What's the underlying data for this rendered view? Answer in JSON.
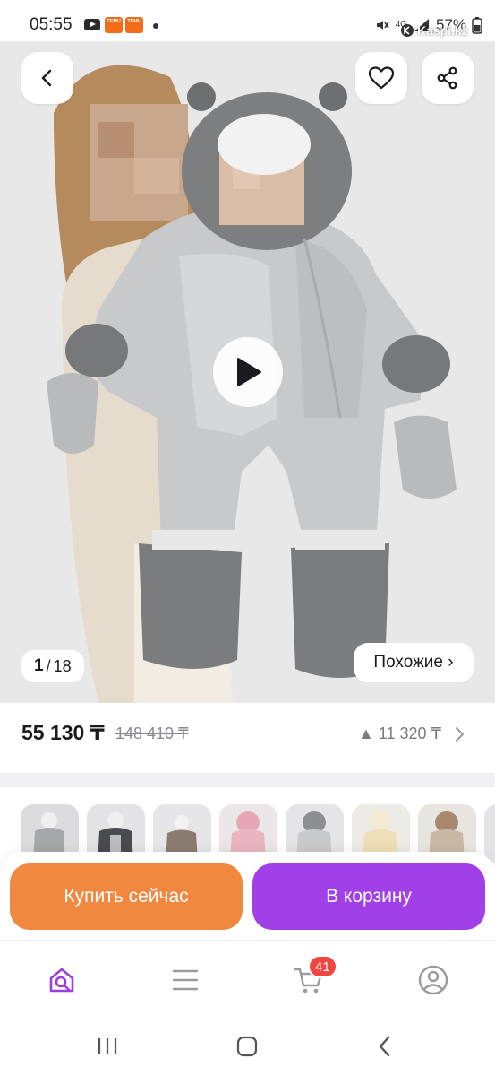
{
  "status_bar": {
    "time": "05:55",
    "battery": "57%",
    "network": "4G",
    "temu_label": "TEMU",
    "temu_label_2": "TEMU"
  },
  "watermark": "Kaspi.kz",
  "gallery": {
    "counter_current": "1",
    "counter_separator": "/",
    "counter_total": "18",
    "similar_label": "Похожие ›",
    "icons": [
      "back-icon",
      "heart-icon",
      "share-icon",
      "play-icon"
    ]
  },
  "price": {
    "current": "55 130 ₸",
    "old": "148 410 ₸",
    "delta": "▲ 11 320 ₸"
  },
  "thumbnails": [
    "photo-1",
    "photo-2",
    "photo-3",
    "photo-4",
    "photo-5",
    "photo-6",
    "photo-7",
    "photo-8"
  ],
  "actions": {
    "buy_now": "Купить сейчас",
    "add_to_cart": "В корзину"
  },
  "bottom_nav": {
    "items": [
      "home-search",
      "menu",
      "cart",
      "profile"
    ],
    "cart_badge": "41"
  },
  "colors": {
    "buy_button": "#f0893f",
    "cart_button": "#a140e6",
    "badge": "#f14640",
    "active_nav": "#9b3fe0"
  }
}
